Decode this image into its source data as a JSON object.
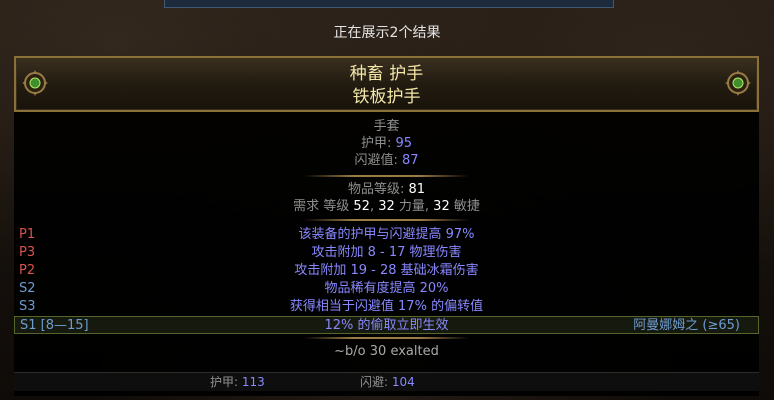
{
  "top": {
    "result_count": "正在展示2个结果"
  },
  "item": {
    "name": "种畜 护手",
    "base": "铁板护手",
    "type": "手套",
    "armour_label": "护甲: ",
    "armour_value": "95",
    "evasion_label": "闪避值: ",
    "evasion_value": "87",
    "ilvl_label": "物品等级: ",
    "ilvl_value": "81",
    "req": {
      "prefix": "需求 等级 ",
      "level": "52",
      "str_sep": ", ",
      "str": "32",
      "str_label": " 力量, ",
      "dex": "32",
      "dex_label": " 敏捷"
    }
  },
  "mods": [
    {
      "tag": "P1",
      "text": "该装备的护甲与闪避提高 97%"
    },
    {
      "tag": "P3",
      "text": "攻击附加 8 - 17 物理伤害"
    },
    {
      "tag": "P2",
      "text": "攻击附加 19 - 28 基础冰霜伤害"
    },
    {
      "tag": "S2",
      "text": "物品稀有度提高 20%"
    },
    {
      "tag": "S3",
      "text": "获得相当于闪避值 17% 的偏转值"
    },
    {
      "tag": "S1 [8—15]",
      "text": "12% 的偷取立即生效",
      "extra": "阿曼娜姆之 (≥65)"
    }
  ],
  "price": "~b/o 30 exalted",
  "stats": {
    "armour_label": "护甲: ",
    "armour_value": "113",
    "evasion_label": "闪避: ",
    "evasion_value": "104"
  },
  "colors": {
    "header_text": "#f4e7a8",
    "mod_text": "#8888ff",
    "prefix_tag": "#d9534f",
    "suffix_tag": "#6e9bd1",
    "border_gold": "#8a7039"
  }
}
